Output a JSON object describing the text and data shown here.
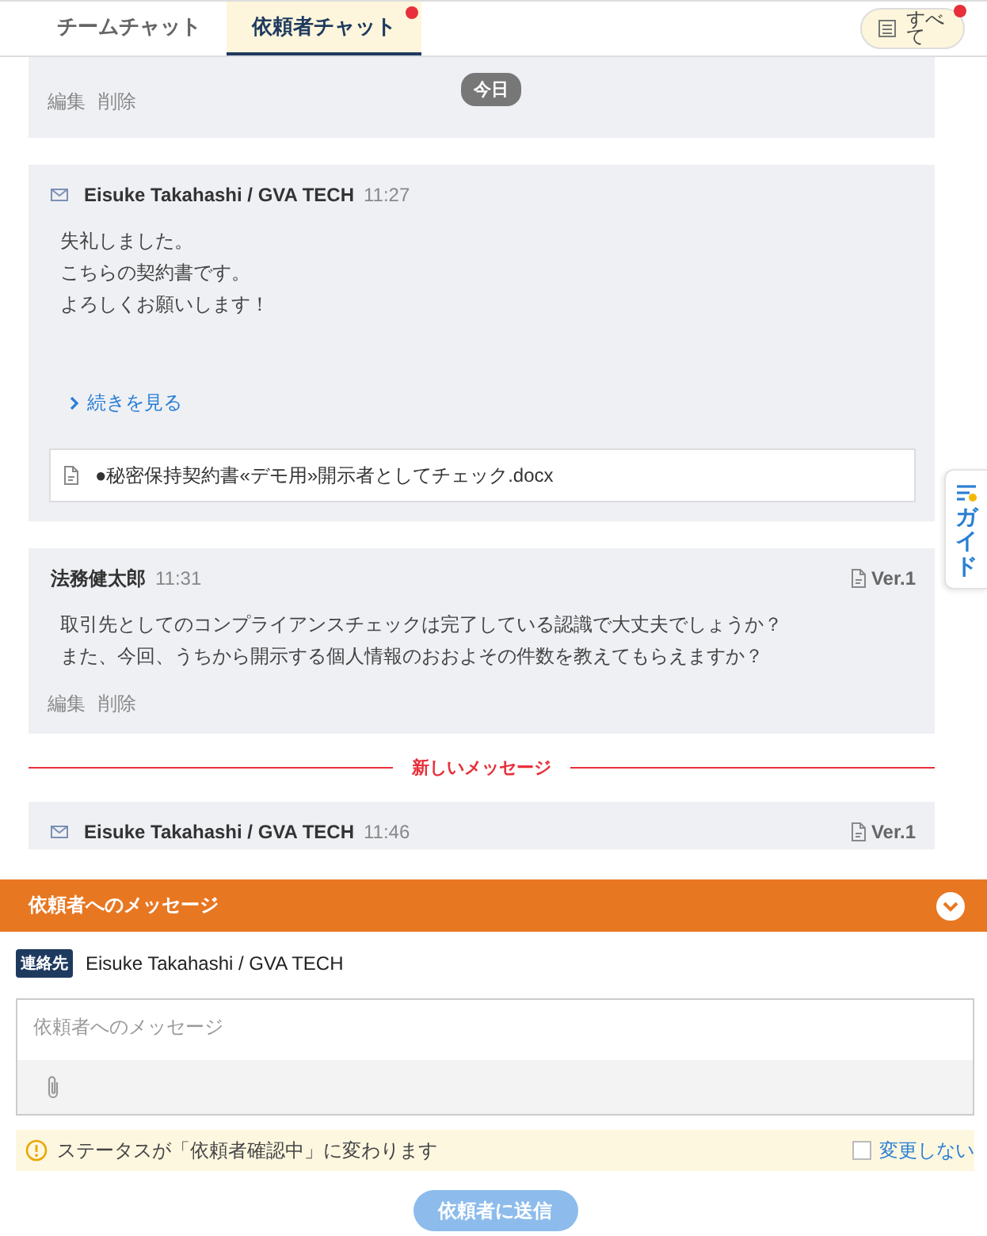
{
  "tabs": [
    {
      "label": "チームチャット",
      "selected": false,
      "unread": false
    },
    {
      "label": "依頼者チャット",
      "selected": true,
      "unread": true
    }
  ],
  "filter": {
    "label": "すべて",
    "unread": true
  },
  "date_badge": "今日",
  "messages": [
    {
      "kind": "partial",
      "actions": [
        "編集",
        "削除"
      ]
    },
    {
      "kind": "email",
      "sender": "Eisuke Takahashi / GVA TECH",
      "time": "11:27",
      "body": [
        "失礼しました。",
        "こちらの契約書です。",
        "よろしくお願いします！"
      ],
      "more_link": "続きを見る",
      "attachment": "●秘密保持契約書«デモ用»開示者としてチェック.docx"
    },
    {
      "kind": "internal",
      "sender": "法務健太郎",
      "time": "11:31",
      "version": "Ver.1",
      "body": [
        "取引先としてのコンプライアンスチェックは完了している認識で大丈夫でしょうか？",
        "また、今回、うちから開示する個人情報のおおよその件数を教えてもらえますか？"
      ],
      "actions": [
        "編集",
        "削除"
      ]
    },
    {
      "kind": "email",
      "sender": "Eisuke Takahashi / GVA TECH",
      "time": "11:46",
      "version": "Ver.1"
    }
  ],
  "new_divider": "新しいメッセージ",
  "guide_tab": "ガイド",
  "composer": {
    "title": "依頼者へのメッセージ",
    "expanded": true,
    "contact_tag": "連絡先",
    "contact": "Eisuke Takahashi / GVA TECH",
    "placeholder": "依頼者へのメッセージ",
    "notice": "ステータスが「依頼者確認中」に変わります",
    "no_change": {
      "label": "変更しない",
      "checked": false
    },
    "send_button": {
      "label": "依頼者に送信",
      "disabled": true
    }
  }
}
